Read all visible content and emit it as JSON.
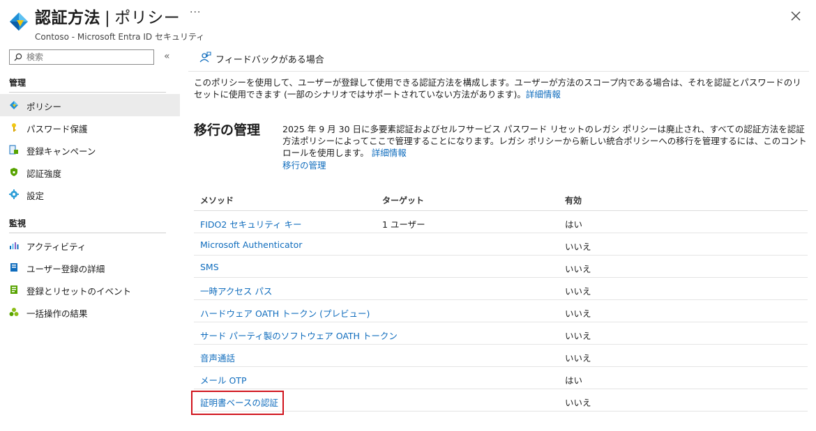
{
  "header": {
    "title": "認証方法",
    "separator": "|",
    "title_suffix": "ポリシー",
    "subtitle": "Contoso - Microsoft Entra ID セキュリティ",
    "more_label": "···"
  },
  "sidebar": {
    "search_placeholder": "検索",
    "collapse_label": "«",
    "sections": [
      {
        "title": "管理",
        "items": [
          {
            "label": "ポリシー",
            "icon": "diamond-policy-icon",
            "active": true
          },
          {
            "label": "パスワード保護",
            "icon": "key-icon"
          },
          {
            "label": "登録キャンペーン",
            "icon": "campaign-icon"
          },
          {
            "label": "認証強度",
            "icon": "shield-icon"
          },
          {
            "label": "設定",
            "icon": "gear-icon"
          }
        ]
      },
      {
        "title": "監視",
        "items": [
          {
            "label": "アクティビティ",
            "icon": "activity-chart-icon"
          },
          {
            "label": "ユーザー登録の詳細",
            "icon": "user-registration-icon"
          },
          {
            "label": "登録とリセットのイベント",
            "icon": "events-icon"
          },
          {
            "label": "一括操作の結果",
            "icon": "bulk-results-icon"
          }
        ]
      }
    ]
  },
  "toolbar": {
    "feedback_label": "フィードバックがある場合"
  },
  "main": {
    "description": "このポリシーを使用して、ユーザーが登録して使用できる認証方法を構成します。ユーザーが方法のスコープ内である場合は、それを認証とパスワードのリセットに使用できます (一部のシナリオではサポートされていない方法があります)。",
    "description_link": "詳細情報",
    "migration": {
      "title": "移行の管理",
      "text": "2025 年 9 月 30 日に多要素認証およびセルフサービス パスワード リセットのレガシ ポリシーは廃止され、すべての認証方法を認証方法ポリシーによってここで管理することになります。レガシ ポリシーから新しい統合ポリシーへの移行を管理するには、このコントロールを使用します。",
      "text_link": "詳細情報",
      "manage_link": "移行の管理"
    },
    "table": {
      "headers": [
        "メソッド",
        "ターゲット",
        "有効"
      ],
      "rows": [
        {
          "method": "FIDO2 セキュリティ キー",
          "target": "1 ユーザー",
          "enabled": "はい"
        },
        {
          "method": "Microsoft Authenticator",
          "target": "",
          "enabled": "いいえ"
        },
        {
          "method": "SMS",
          "target": "",
          "enabled": "いいえ"
        },
        {
          "method": "一時アクセス パス",
          "target": "",
          "enabled": "いいえ"
        },
        {
          "method": "ハードウェア OATH トークン (プレビュー)",
          "target": "",
          "enabled": "いいえ"
        },
        {
          "method": "サード パーティ製のソフトウェア OATH トークン",
          "target": "",
          "enabled": "いいえ"
        },
        {
          "method": "音声通話",
          "target": "",
          "enabled": "いいえ"
        },
        {
          "method": "メール OTP",
          "target": "",
          "enabled": "はい"
        },
        {
          "method": "証明書ベースの認証",
          "target": "",
          "enabled": "いいえ"
        }
      ]
    }
  },
  "colors": {
    "accent": "#0f6cbd",
    "highlight_box": "#d0121b",
    "active_nav_bg": "#ebebeb"
  }
}
